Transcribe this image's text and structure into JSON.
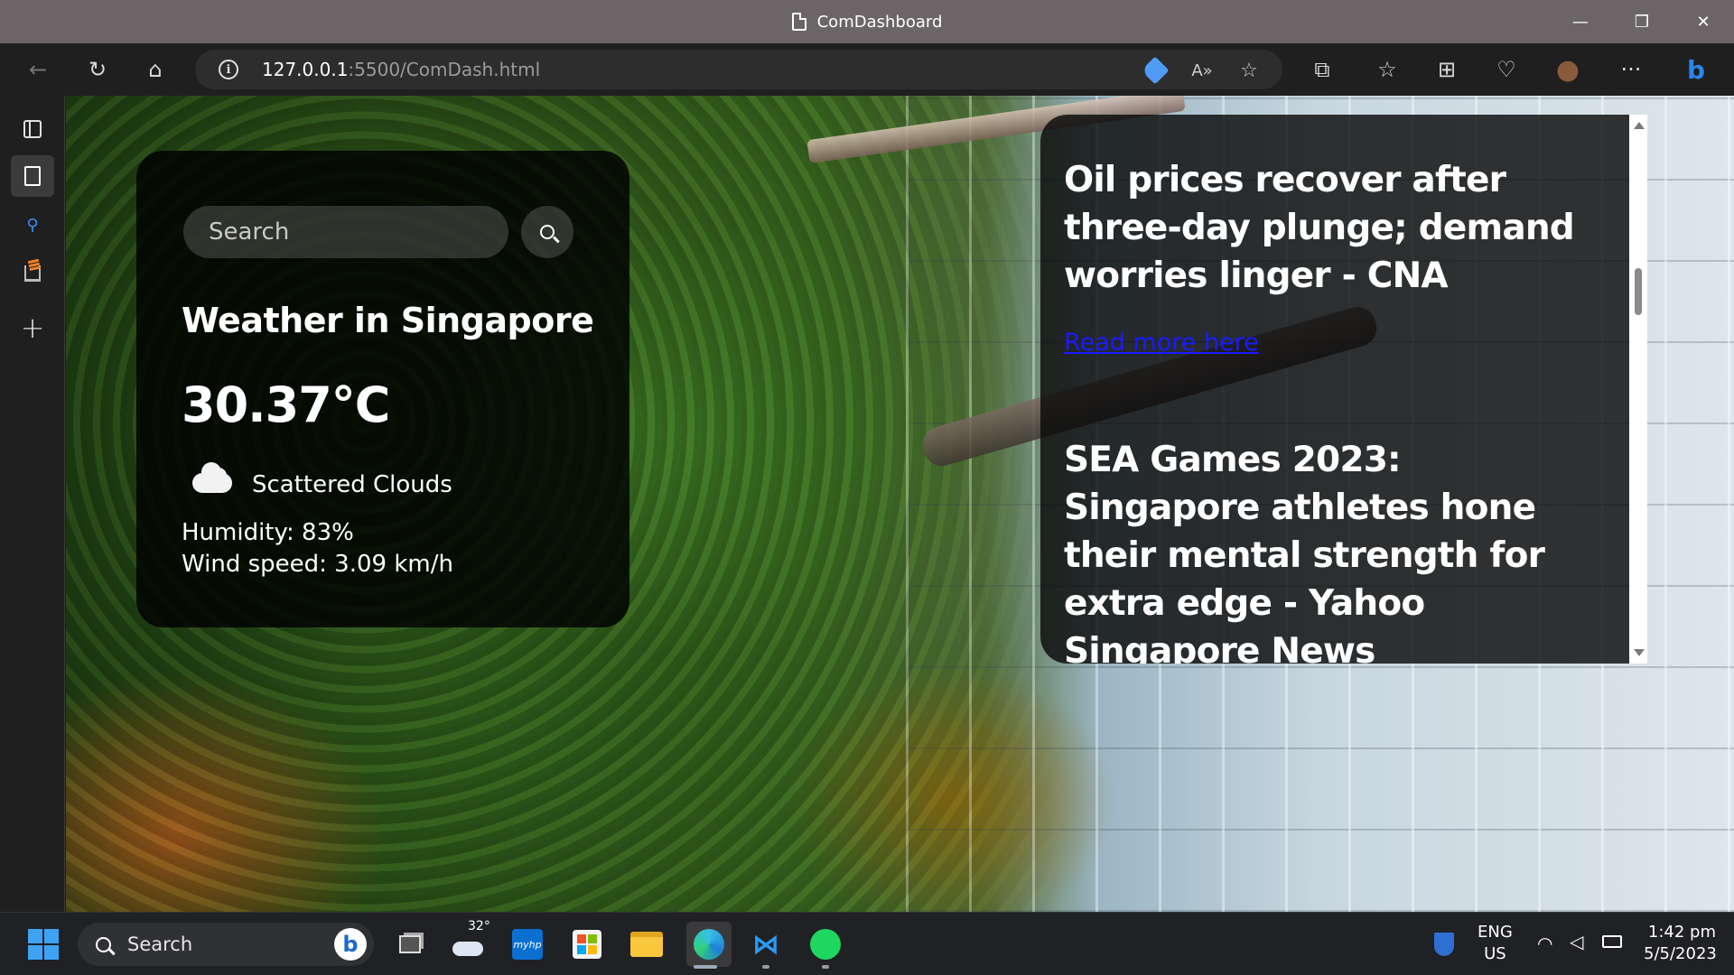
{
  "window": {
    "title": "ComDashboard",
    "controls": {
      "minimize": "—",
      "restore": "❐",
      "close": "✕"
    }
  },
  "nav": {
    "back_icon": "←",
    "refresh_icon": "↻",
    "home_icon": "⌂",
    "info_icon": "i",
    "url_host": "127.0.0.1",
    "url_rest": ":5500/ComDash.html",
    "read_aloud_icon": "A»",
    "add_fav_icon": "☆",
    "extensions_icon": "⧉",
    "favorites_icon": "☆",
    "collections_icon": "⊞",
    "health_icon": "♡",
    "profile_icon": "●",
    "more_icon": "···",
    "copilot_icon": "b"
  },
  "weather": {
    "search_placeholder": "Search",
    "city_line": "Weather in Singapore",
    "temperature": "30.37°C",
    "description": "Scattered Clouds",
    "humidity": "Humidity: 83%",
    "wind": "Wind speed: 3.09 km/h"
  },
  "news": {
    "items": [
      {
        "title": "Oil prices recover after three-day plunge; demand worries linger - CNA",
        "link": "Read more here"
      },
      {
        "title": "SEA Games 2023: Singapore athletes hone their mental strength for extra edge - Yahoo Singapore News",
        "link": ""
      }
    ]
  },
  "taskbar": {
    "search_label": "Search",
    "bing_icon": "b",
    "weather_temp": "32°",
    "myhp_label": "myhp",
    "lang_top": "ENG",
    "lang_bottom": "US",
    "time": "1:42 pm",
    "date": "5/5/2023"
  },
  "colors": {
    "accent": "#3c8ef3",
    "link": "#1a1aff",
    "titlebar": "#6b6567"
  }
}
